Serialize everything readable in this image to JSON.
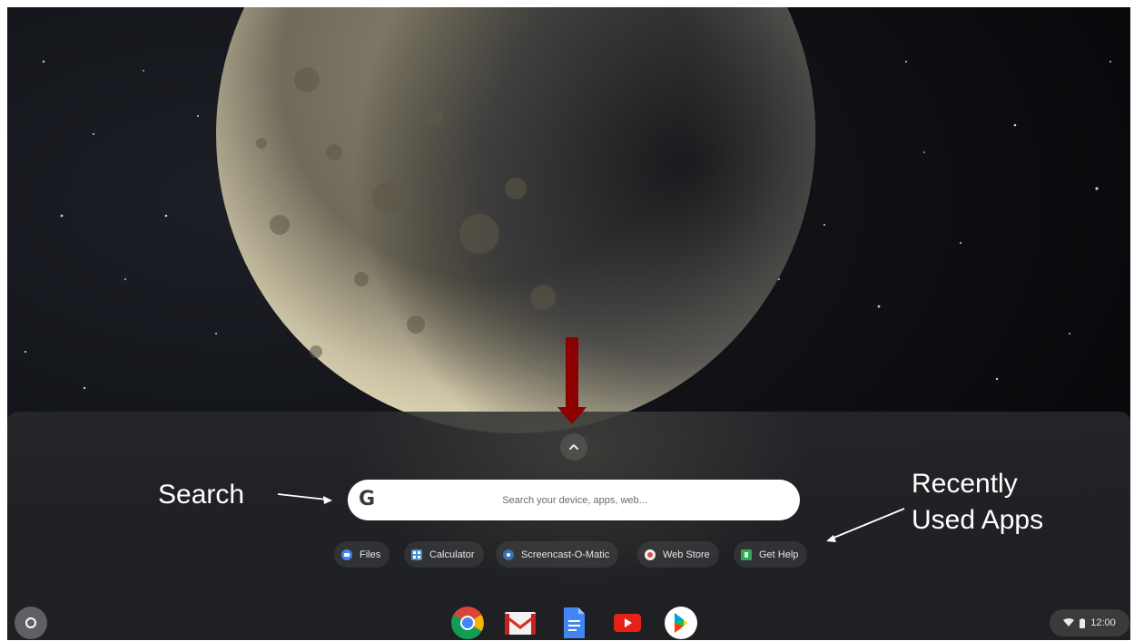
{
  "launcher": {
    "search": {
      "placeholder": "Search your device, apps, web...",
      "g_glyph": "G"
    },
    "recent_apps": [
      {
        "label": "Files",
        "icon": "files-icon",
        "color": "#4285f4"
      },
      {
        "label": "Calculator",
        "icon": "calculator-icon",
        "color": "#4a90c8"
      },
      {
        "label": "Screencast-O-Matic",
        "icon": "screencast-icon",
        "color": "#3b6fb6"
      },
      {
        "label": "Web Store",
        "icon": "web-store-icon",
        "color": "#e74c3c"
      },
      {
        "label": "Get Help",
        "icon": "get-help-icon",
        "color": "#34a853"
      }
    ]
  },
  "shelf": {
    "apps": [
      {
        "name": "Chrome",
        "icon": "chrome-icon"
      },
      {
        "name": "Gmail",
        "icon": "gmail-icon"
      },
      {
        "name": "Docs",
        "icon": "docs-icon"
      },
      {
        "name": "YouTube",
        "icon": "youtube-icon"
      },
      {
        "name": "Play Store",
        "icon": "play-store-icon"
      }
    ],
    "time": "12:00"
  },
  "annotations": {
    "search_label": "Search",
    "recent_label_line1": "Recently",
    "recent_label_line2": "Used Apps",
    "arrow_color": "#8b0000"
  }
}
